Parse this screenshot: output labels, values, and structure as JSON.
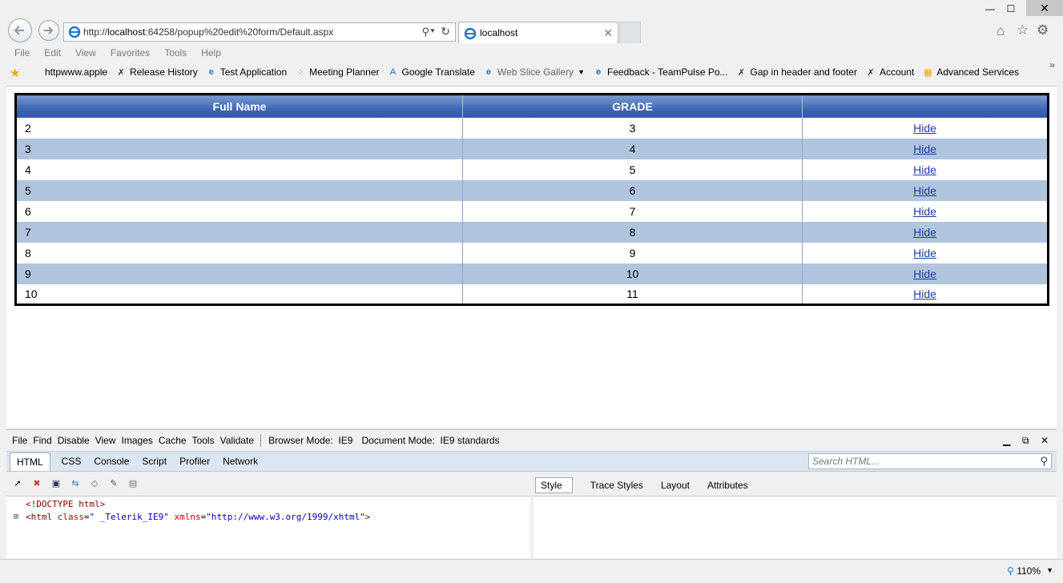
{
  "browser": {
    "address_url": "http://localhost:64258/popup%20edit%20form/Default.aspx",
    "tab_title": "localhost",
    "menu": [
      "File",
      "Edit",
      "View",
      "Favorites",
      "Tools",
      "Help"
    ],
    "favorites": [
      {
        "label": "httpwww.apple",
        "icon": "apple-icon"
      },
      {
        "label": "Release History",
        "icon": "xenon-icon"
      },
      {
        "label": "Test Application",
        "icon": "ie-page-icon"
      },
      {
        "label": "Meeting Planner",
        "icon": "dots-icon"
      },
      {
        "label": "Google Translate",
        "icon": "translate-icon"
      },
      {
        "label": "Web Slice Gallery",
        "icon": "ie-page-icon"
      },
      {
        "label": "Feedback - TeamPulse Po...",
        "icon": "ie-page-icon"
      },
      {
        "label": "Gap in header and footer",
        "icon": "xenon-icon"
      },
      {
        "label": "Account",
        "icon": "xenon-icon"
      },
      {
        "label": "Advanced Services",
        "icon": "grid-icon"
      }
    ]
  },
  "grid": {
    "headers": [
      "Full Name",
      "GRADE",
      ""
    ],
    "rows": [
      {
        "name": "2",
        "grade": "3",
        "action": "Hide"
      },
      {
        "name": "3",
        "grade": "4",
        "action": "Hide"
      },
      {
        "name": "4",
        "grade": "5",
        "action": "Hide"
      },
      {
        "name": "5",
        "grade": "6",
        "action": "Hide"
      },
      {
        "name": "6",
        "grade": "7",
        "action": "Hide"
      },
      {
        "name": "7",
        "grade": "8",
        "action": "Hide"
      },
      {
        "name": "8",
        "grade": "9",
        "action": "Hide"
      },
      {
        "name": "9",
        "grade": "10",
        "action": "Hide"
      },
      {
        "name": "10",
        "grade": "11",
        "action": "Hide"
      }
    ]
  },
  "devtools": {
    "menu": [
      "File",
      "Find",
      "Disable",
      "View",
      "Images",
      "Cache",
      "Tools",
      "Validate"
    ],
    "browser_mode": "Browser Mode:  IE9",
    "document_mode": "Document Mode:  IE9 standards",
    "tabs": [
      "HTML",
      "CSS",
      "Console",
      "Script",
      "Profiler",
      "Network"
    ],
    "search_placeholder": "Search HTML...",
    "right_tabs": [
      "Style",
      "Trace Styles",
      "Layout",
      "Attributes"
    ],
    "code_line1": "<!DOCTYPE html>",
    "code_line2_tag": "<html",
    "code_line2_attr1": "class",
    "code_line2_val1": "\" _Telerik_IE9\"",
    "code_line2_attr2": "xmlns",
    "code_line2_val2": "\"http://www.w3.org/1999/xhtml\"",
    "code_line2_end": ">"
  },
  "status": {
    "zoom": "110%"
  }
}
